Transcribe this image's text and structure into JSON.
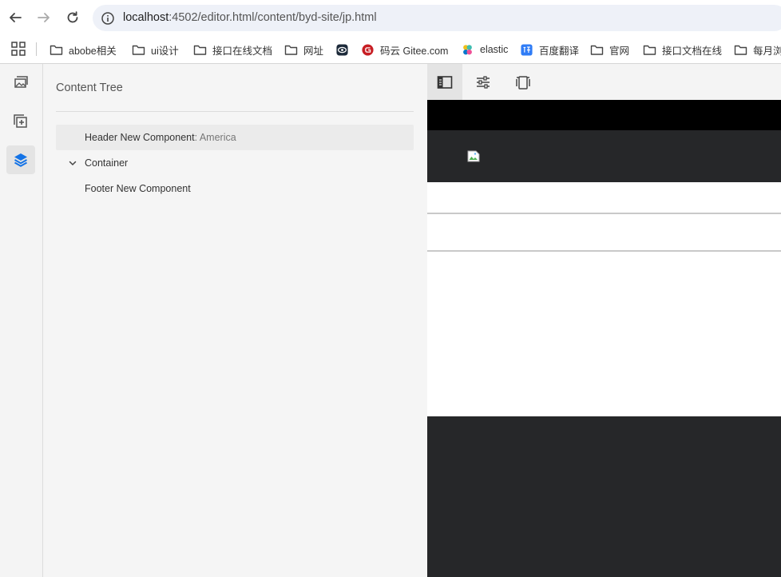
{
  "browser": {
    "url_host": "localhost",
    "url_rest": ":4502/editor.html/content/byd-site/jp.html"
  },
  "bookmarks": [
    {
      "label": "abobe相关",
      "icon": "folder-icon"
    },
    {
      "label": "ui设计",
      "icon": "folder-icon"
    },
    {
      "label": "接口在线文档",
      "icon": "folder-icon"
    },
    {
      "label": "网址",
      "icon": "folder-icon"
    },
    {
      "label": "",
      "icon": "eye-logo-icon"
    },
    {
      "label": "码云 Gitee.com",
      "icon": "gitee-icon"
    },
    {
      "label": "elastic",
      "icon": "elastic-icon"
    },
    {
      "label": "百度翻译",
      "icon": "baidu-translate-icon"
    },
    {
      "label": "官网",
      "icon": "folder-icon"
    },
    {
      "label": "接口文档在线",
      "icon": "folder-icon"
    },
    {
      "label": "每月浏",
      "icon": "folder-icon"
    }
  ],
  "panel": {
    "title": "Content Tree",
    "tree": [
      {
        "label": "Header New Component",
        "sub": ": America",
        "selected": true,
        "expandable": false
      },
      {
        "label": "Container",
        "sub": "",
        "selected": false,
        "expandable": true
      },
      {
        "label": "Footer New Component",
        "sub": "",
        "selected": false,
        "expandable": false
      }
    ]
  },
  "colors": {
    "accent": "#1473e6",
    "site_dark": "#262729",
    "site_topbar": "#000000"
  }
}
